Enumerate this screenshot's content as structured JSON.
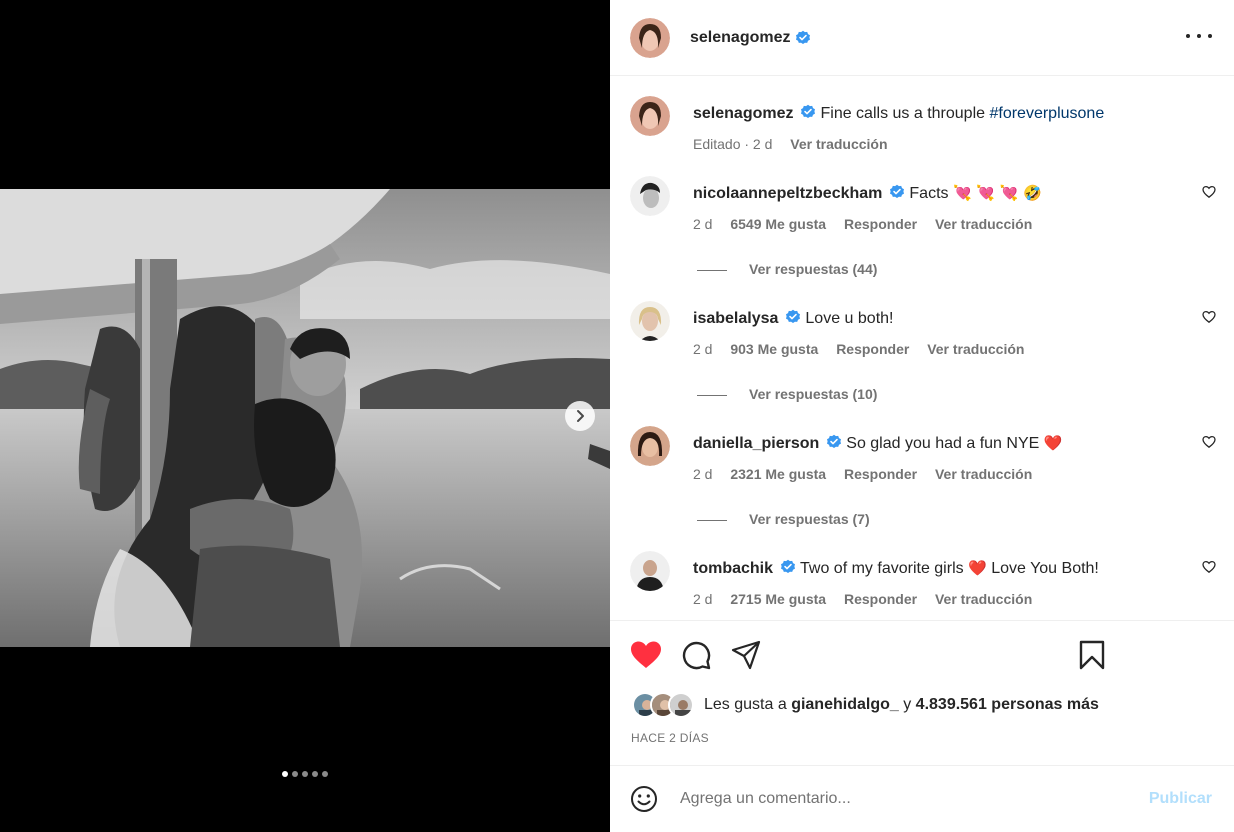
{
  "post": {
    "author": "selenagomez",
    "caption": "Fine calls us a throuple",
    "hashtag": "#foreverplusone",
    "caption_meta": {
      "edited": "Editado · 2 d",
      "translate": "Ver traducción"
    },
    "carousel": {
      "total": 5,
      "active": 1
    }
  },
  "comments": [
    {
      "user": "nicolaannepeltzbeckham",
      "text": "Facts",
      "emoji": "💘 💘 💘 🤣",
      "age": "2 d",
      "likes": "6549 Me gusta",
      "reply": "Responder",
      "translate": "Ver traducción",
      "replies": "Ver respuestas (44)"
    },
    {
      "user": "isabelalysa",
      "text": "Love u both!",
      "emoji": "",
      "age": "2 d",
      "likes": "903 Me gusta",
      "reply": "Responder",
      "translate": "Ver traducción",
      "replies": "Ver respuestas (10)"
    },
    {
      "user": "daniella_pierson",
      "text": "So glad you had a fun NYE",
      "emoji": "❤️",
      "age": "2 d",
      "likes": "2321 Me gusta",
      "reply": "Responder",
      "translate": "Ver traducción",
      "replies": "Ver respuestas (7)"
    },
    {
      "user": "tombachik",
      "text": "Two of my favorite girls",
      "emoji": "❤️",
      "text_after": "Love You Both!",
      "age": "2 d",
      "likes": "2715 Me gusta",
      "reply": "Responder",
      "translate": "Ver traducción"
    }
  ],
  "likes_line": {
    "prefix": "Les gusta a",
    "user": "gianehidalgo_",
    "connector": "y",
    "rest": "4.839.561 personas más"
  },
  "timestamp": "HACE 2 DÍAS",
  "composer": {
    "placeholder": "Agrega un comentario...",
    "publish": "Publicar"
  },
  "colors": {
    "verified": "#3897f0",
    "like_red": "#ff3040",
    "hashtag": "#00376b",
    "publish_disabled": "#b2dffc"
  },
  "icons": [
    "more-options-icon",
    "verified-badge-icon",
    "heart-icon",
    "comment-icon",
    "share-icon",
    "bookmark-icon",
    "emoji-icon",
    "chevron-right-icon"
  ]
}
